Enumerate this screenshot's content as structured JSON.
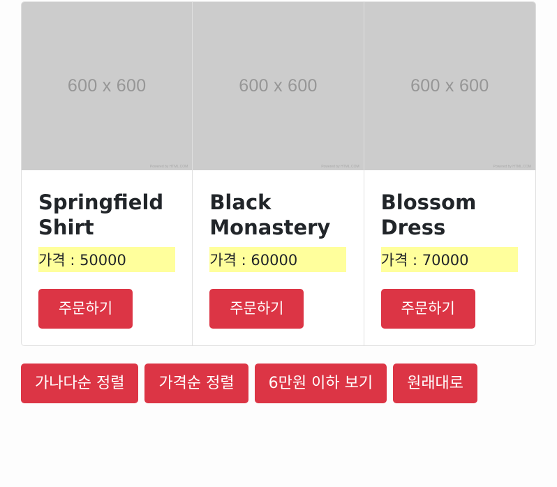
{
  "products": [
    {
      "image_placeholder": "600 x 600",
      "image_credit": "Powered by HTML.COM",
      "title_line1": "Springfield",
      "title_line2": "Shirt",
      "price_label": "가격 : 50000",
      "order_button": "주문하기"
    },
    {
      "image_placeholder": "600 x 600",
      "image_credit": "Powered by HTML.COM",
      "title_line1": "Black",
      "title_line2": "Monastery",
      "price_label": "가격 : 60000",
      "order_button": "주문하기"
    },
    {
      "image_placeholder": "600 x 600",
      "image_credit": "Powered by HTML.COM",
      "title_line1": "Blossom",
      "title_line2": "Dress",
      "price_label": "가격 : 70000",
      "order_button": "주문하기"
    }
  ],
  "controls": {
    "sort_by_name": "가나다순 정렬",
    "sort_by_price": "가격순 정렬",
    "filter_under_60000": "6만원 이하 보기",
    "reset": "원래대로"
  },
  "colors": {
    "button_bg": "#dc3545",
    "price_highlight": "#ffff9c",
    "placeholder_bg": "#cccccc"
  }
}
